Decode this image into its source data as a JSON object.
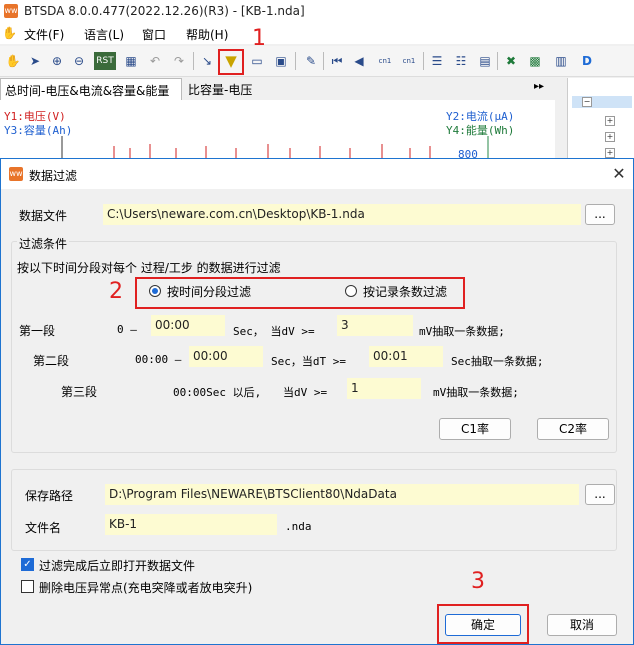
{
  "app": {
    "title": "BTSDA 8.0.0.477(2022.12.26)(R3) - [KB-1.nda]",
    "logo_text": "ww"
  },
  "menu": {
    "file": "文件(F)",
    "language": "语言(L)",
    "window": "窗口",
    "help": "帮助(H)"
  },
  "toolbar": {
    "rst_label": "RST",
    "d_label": "D",
    "cn1a": "cn1",
    "cn1b": "cn1"
  },
  "annotations": {
    "step1": "1",
    "step2": "2",
    "step3": "3"
  },
  "tabs": {
    "tab1": "总时间-电压&电流&容量&能量",
    "tab2": "比容量-电压",
    "nav": "▸▸"
  },
  "chart": {
    "y1": "Y1:电压(V)",
    "y3": "Y3:容量(Ah)",
    "y2": "Y2:电流(μA)",
    "y4": "Y4:能量(Wh)",
    "tick_800": "800"
  },
  "dialog": {
    "title": "数据过滤",
    "data_file_label": "数据文件",
    "data_file_value": "C:\\Users\\neware.com.cn\\Desktop\\KB-1.nda",
    "browse": "...",
    "filter_group": "过滤条件",
    "filter_desc": "按以下时间分段对每个 过程/工步 的数据进行过滤",
    "radio_time": "按时间分段过滤",
    "radio_count": "按记录条数过滤",
    "seg1": {
      "label": "第一段",
      "start": "0 —",
      "time": "00:00",
      "sec_text": "Sec，  当dV >=",
      "value": "3",
      "tail": "mV抽取一条数据;"
    },
    "seg2": {
      "label": "第二段",
      "start": "00:00 —",
      "time": "00:00",
      "sec_text": "Sec，当dT >=",
      "value": "00:01",
      "tail": "Sec抽取一条数据;"
    },
    "seg3": {
      "label": "第三段",
      "start": "00:00Sec 以后,",
      "cond": "当dV >=",
      "value": "1",
      "tail": "mV抽取一条数据;"
    },
    "c1_button": "C1率",
    "c2_button": "C2率",
    "save_path_label": "保存路径",
    "save_path_value": "D:\\Program Files\\NEWARE\\BTSClient80\\NdaData",
    "file_name_label": "文件名",
    "file_name_value": "KB-1",
    "ext": ".nda",
    "open_after": "过滤完成后立即打开数据文件",
    "delete_abnormal": "删除电压异常点(充电突降或者放电突升)",
    "ok": "确定",
    "cancel": "取消",
    "close_glyph": "✕"
  }
}
